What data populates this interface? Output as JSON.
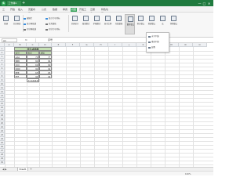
{
  "titlebar": {
    "app_letter": "S",
    "doc_tab": "工作簿1",
    "add_tab": "+"
  },
  "window": {
    "min": "—",
    "max": "□",
    "close": "✕"
  },
  "menu": {
    "items": [
      {
        "label": "三",
        "active": false
      },
      {
        "label": "开始",
        "active": false
      },
      {
        "label": "插入",
        "active": false
      },
      {
        "label": "页面布局",
        "active": false
      },
      {
        "label": "公式",
        "active": false
      },
      {
        "label": "数据",
        "active": false
      },
      {
        "label": "审阅",
        "active": false
      },
      {
        "label": "视图",
        "active": true
      },
      {
        "label": "开发工具",
        "active": false
      },
      {
        "label": "云服务",
        "active": false
      },
      {
        "label": "特色功能",
        "active": false
      }
    ]
  },
  "ribbon": {
    "buttons": [
      {
        "label": "普通",
        "selected": false
      },
      {
        "label": "分页预览",
        "selected": false
      },
      {
        "label": "全屏显示",
        "selected": false
      },
      {
        "label": "阅读模式",
        "selected": false
      },
      {
        "label": "护眼模式",
        "selected": false
      },
      {
        "label": "显示比例",
        "selected": false
      },
      {
        "label": "冻结窗格",
        "selected": false
      },
      {
        "label": "重排窗口",
        "selected": true
      },
      {
        "label": "拆分窗口",
        "selected": false
      },
      {
        "label": "新建窗口",
        "selected": false
      },
      {
        "label": "宏",
        "selected": false
      },
      {
        "label": "切换窗口",
        "selected": false
      }
    ],
    "checks": [
      {
        "label": "编辑栏",
        "on": true
      },
      {
        "label": "显示网格线",
        "on": true
      },
      {
        "label": "显示行号列标",
        "on": true
      },
      {
        "label": "任务窗格",
        "on": false
      },
      {
        "label": "打印网格线",
        "on": false
      },
      {
        "label": "打印行号列标",
        "on": false
      }
    ]
  },
  "formula": {
    "cell_ref": "A1",
    "fx": "fx",
    "value": "序号"
  },
  "grid": {
    "columns": [
      "A",
      "B",
      "C",
      "D",
      "E",
      "F",
      "G",
      "H",
      "I",
      "J",
      "K",
      "L",
      "M",
      "N",
      "O"
    ],
    "rows": [
      "1",
      "2",
      "3",
      "4",
      "5",
      "6",
      "7",
      "8",
      "9",
      "10",
      "11",
      "12",
      "13",
      "14",
      "15",
      "16",
      "17",
      "18",
      "19",
      "20",
      "21",
      "22",
      "23",
      "24",
      "25",
      "26",
      "27",
      "28",
      "29",
      "30"
    ]
  },
  "table": {
    "title": "学生成绩表",
    "headers": [
      "序号",
      "姓名",
      "成绩"
    ],
    "rows": [
      [
        "1",
        "AAA",
        "70",
        "77"
      ],
      [
        "2",
        "BBB",
        "84",
        "84"
      ],
      [
        "3",
        "CCC",
        "69",
        "69"
      ],
      [
        "4",
        "DDD",
        "92",
        "92"
      ],
      [
        "5",
        "EEE",
        "65",
        "65"
      ],
      [
        "6",
        "FFF",
        "94",
        "94"
      ]
    ],
    "average": "77.3333333"
  },
  "dropdown": {
    "items": [
      "水平平铺",
      "垂直平铺",
      "层叠"
    ]
  },
  "sheetbar": {
    "nav": "◀ ▶",
    "tab": "Sheet1",
    "add": "+"
  },
  "status": {
    "zoom": "100%"
  }
}
